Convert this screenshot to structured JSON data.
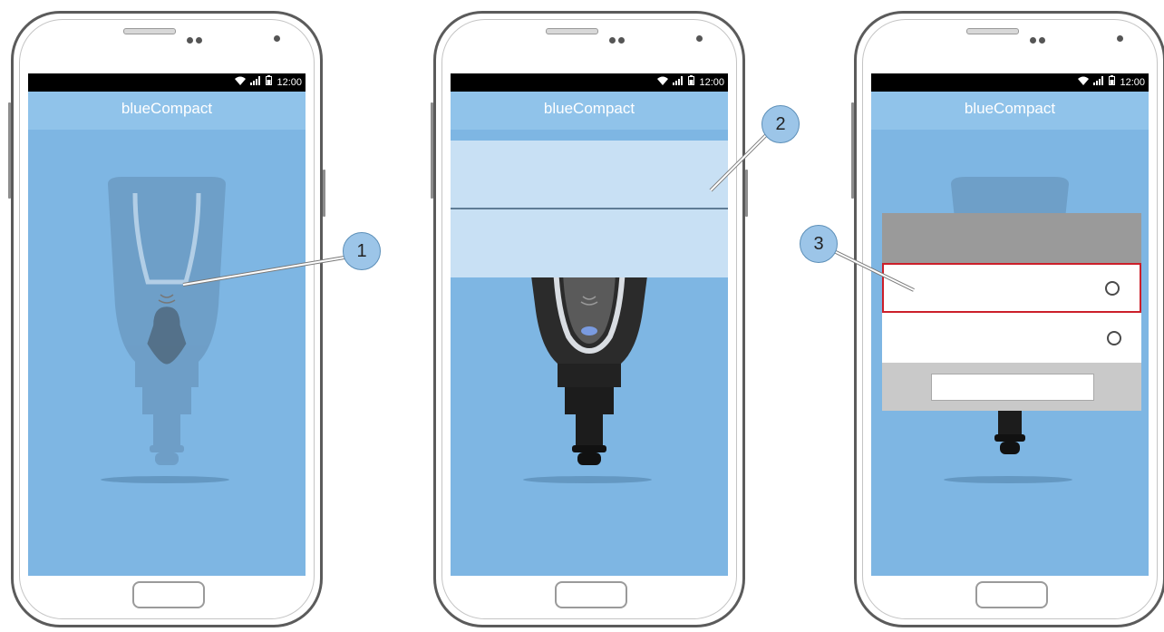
{
  "phones": [
    {
      "status_icons": "▼.▌▐",
      "time": "12:00",
      "app_title": "blueCompact"
    },
    {
      "status_icons": "▼.▌▐",
      "time": "12:00",
      "app_title": "blueCompact"
    },
    {
      "status_icons": "▼.▌▐",
      "time": "12:00",
      "app_title": "blueCompact"
    }
  ],
  "callouts": [
    "1",
    "2",
    "3"
  ],
  "colors": {
    "screen_bg": "#7eb6e3",
    "header_bg": "#90c3ea",
    "callout_fill": "#9cc5e8",
    "selection_border": "#cc1f2a",
    "dialog_title_bg": "#9a9a9a"
  },
  "icons": [
    "wifi-icon",
    "signal-icon",
    "battery-icon",
    "radio-button-icon",
    "nfc-icon",
    "home-button-icon"
  ]
}
